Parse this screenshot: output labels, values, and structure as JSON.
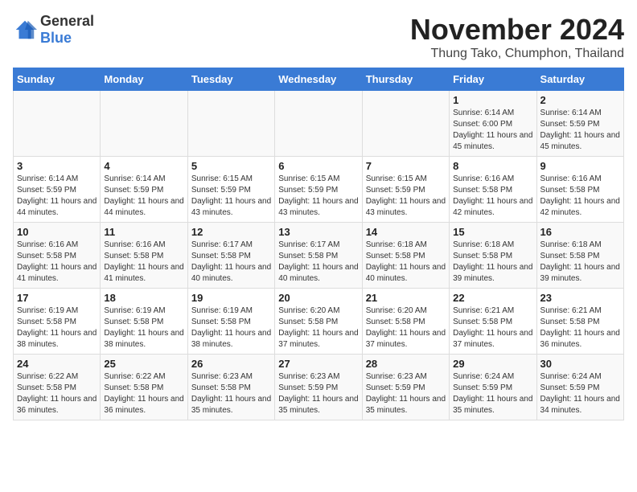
{
  "header": {
    "logo_general": "General",
    "logo_blue": "Blue",
    "title": "November 2024",
    "subtitle": "Thung Tako, Chumphon, Thailand"
  },
  "days_of_week": [
    "Sunday",
    "Monday",
    "Tuesday",
    "Wednesday",
    "Thursday",
    "Friday",
    "Saturday"
  ],
  "weeks": [
    [
      {
        "day": "",
        "info": ""
      },
      {
        "day": "",
        "info": ""
      },
      {
        "day": "",
        "info": ""
      },
      {
        "day": "",
        "info": ""
      },
      {
        "day": "",
        "info": ""
      },
      {
        "day": "1",
        "info": "Sunrise: 6:14 AM\nSunset: 6:00 PM\nDaylight: 11 hours and 45 minutes."
      },
      {
        "day": "2",
        "info": "Sunrise: 6:14 AM\nSunset: 5:59 PM\nDaylight: 11 hours and 45 minutes."
      }
    ],
    [
      {
        "day": "3",
        "info": "Sunrise: 6:14 AM\nSunset: 5:59 PM\nDaylight: 11 hours and 44 minutes."
      },
      {
        "day": "4",
        "info": "Sunrise: 6:14 AM\nSunset: 5:59 PM\nDaylight: 11 hours and 44 minutes."
      },
      {
        "day": "5",
        "info": "Sunrise: 6:15 AM\nSunset: 5:59 PM\nDaylight: 11 hours and 43 minutes."
      },
      {
        "day": "6",
        "info": "Sunrise: 6:15 AM\nSunset: 5:59 PM\nDaylight: 11 hours and 43 minutes."
      },
      {
        "day": "7",
        "info": "Sunrise: 6:15 AM\nSunset: 5:59 PM\nDaylight: 11 hours and 43 minutes."
      },
      {
        "day": "8",
        "info": "Sunrise: 6:16 AM\nSunset: 5:58 PM\nDaylight: 11 hours and 42 minutes."
      },
      {
        "day": "9",
        "info": "Sunrise: 6:16 AM\nSunset: 5:58 PM\nDaylight: 11 hours and 42 minutes."
      }
    ],
    [
      {
        "day": "10",
        "info": "Sunrise: 6:16 AM\nSunset: 5:58 PM\nDaylight: 11 hours and 41 minutes."
      },
      {
        "day": "11",
        "info": "Sunrise: 6:16 AM\nSunset: 5:58 PM\nDaylight: 11 hours and 41 minutes."
      },
      {
        "day": "12",
        "info": "Sunrise: 6:17 AM\nSunset: 5:58 PM\nDaylight: 11 hours and 40 minutes."
      },
      {
        "day": "13",
        "info": "Sunrise: 6:17 AM\nSunset: 5:58 PM\nDaylight: 11 hours and 40 minutes."
      },
      {
        "day": "14",
        "info": "Sunrise: 6:18 AM\nSunset: 5:58 PM\nDaylight: 11 hours and 40 minutes."
      },
      {
        "day": "15",
        "info": "Sunrise: 6:18 AM\nSunset: 5:58 PM\nDaylight: 11 hours and 39 minutes."
      },
      {
        "day": "16",
        "info": "Sunrise: 6:18 AM\nSunset: 5:58 PM\nDaylight: 11 hours and 39 minutes."
      }
    ],
    [
      {
        "day": "17",
        "info": "Sunrise: 6:19 AM\nSunset: 5:58 PM\nDaylight: 11 hours and 38 minutes."
      },
      {
        "day": "18",
        "info": "Sunrise: 6:19 AM\nSunset: 5:58 PM\nDaylight: 11 hours and 38 minutes."
      },
      {
        "day": "19",
        "info": "Sunrise: 6:19 AM\nSunset: 5:58 PM\nDaylight: 11 hours and 38 minutes."
      },
      {
        "day": "20",
        "info": "Sunrise: 6:20 AM\nSunset: 5:58 PM\nDaylight: 11 hours and 37 minutes."
      },
      {
        "day": "21",
        "info": "Sunrise: 6:20 AM\nSunset: 5:58 PM\nDaylight: 11 hours and 37 minutes."
      },
      {
        "day": "22",
        "info": "Sunrise: 6:21 AM\nSunset: 5:58 PM\nDaylight: 11 hours and 37 minutes."
      },
      {
        "day": "23",
        "info": "Sunrise: 6:21 AM\nSunset: 5:58 PM\nDaylight: 11 hours and 36 minutes."
      }
    ],
    [
      {
        "day": "24",
        "info": "Sunrise: 6:22 AM\nSunset: 5:58 PM\nDaylight: 11 hours and 36 minutes."
      },
      {
        "day": "25",
        "info": "Sunrise: 6:22 AM\nSunset: 5:58 PM\nDaylight: 11 hours and 36 minutes."
      },
      {
        "day": "26",
        "info": "Sunrise: 6:23 AM\nSunset: 5:58 PM\nDaylight: 11 hours and 35 minutes."
      },
      {
        "day": "27",
        "info": "Sunrise: 6:23 AM\nSunset: 5:59 PM\nDaylight: 11 hours and 35 minutes."
      },
      {
        "day": "28",
        "info": "Sunrise: 6:23 AM\nSunset: 5:59 PM\nDaylight: 11 hours and 35 minutes."
      },
      {
        "day": "29",
        "info": "Sunrise: 6:24 AM\nSunset: 5:59 PM\nDaylight: 11 hours and 35 minutes."
      },
      {
        "day": "30",
        "info": "Sunrise: 6:24 AM\nSunset: 5:59 PM\nDaylight: 11 hours and 34 minutes."
      }
    ]
  ]
}
